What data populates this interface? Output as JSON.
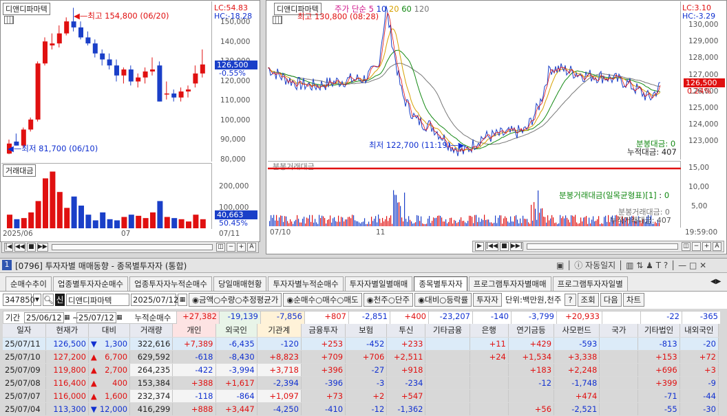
{
  "left_chart": {
    "name": "디앤디파마텍",
    "lc": "LC:54.83",
    "hc": "HC:-18.28",
    "high": "최고 154,800 (06/20)",
    "low": "최저 81,700 (06/10)",
    "yticks": [
      "150,000",
      "140,000",
      "130,000",
      "120,000",
      "110,000",
      "100,000",
      "90,000",
      "80,000"
    ],
    "price": "126,500",
    "pct": "-0.55%",
    "vol_title": "거래대금",
    "vol_yticks": [
      "200,000",
      "100,000"
    ],
    "vol_value": "40,663",
    "vol_pct": "50.45%",
    "xlabels": [
      "2025/06",
      "07",
      "07/11"
    ],
    "candles": [
      [
        82,
        89,
        81.7,
        87
      ],
      [
        88,
        92,
        86,
        86
      ],
      [
        86,
        95,
        85,
        94
      ],
      [
        94,
        100,
        93,
        99
      ],
      [
        99,
        128,
        98,
        127
      ],
      [
        127,
        140,
        126,
        138
      ],
      [
        136,
        142,
        134,
        137
      ],
      [
        137,
        146,
        135,
        142
      ],
      [
        142,
        150,
        141,
        148
      ],
      [
        148,
        154.8,
        143,
        145
      ],
      [
        145,
        148,
        139,
        140
      ],
      [
        140,
        143,
        136,
        137
      ],
      [
        137,
        139,
        130,
        132
      ],
      [
        132,
        134,
        126,
        129
      ],
      [
        129,
        132,
        124,
        126
      ],
      [
        126,
        129,
        118,
        121
      ],
      [
        121,
        125,
        117,
        124
      ],
      [
        124,
        126,
        116,
        118
      ],
      [
        118,
        122,
        115,
        120
      ],
      [
        120,
        125,
        117,
        123
      ],
      [
        123,
        130,
        121,
        124
      ],
      [
        126,
        128,
        108,
        108
      ],
      [
        112,
        118,
        109,
        112
      ],
      [
        112,
        114,
        108,
        110
      ],
      [
        110,
        115,
        108,
        113
      ],
      [
        113,
        116,
        110,
        114
      ],
      [
        117,
        126,
        115,
        122
      ],
      [
        122,
        134,
        120,
        126.5
      ]
    ],
    "vols": [
      60,
      40,
      45,
      70,
      120,
      220,
      250,
      160,
      90,
      140,
      100,
      60,
      35,
      70,
      40,
      35,
      50,
      60,
      55,
      45,
      70,
      120,
      50,
      45,
      40,
      30,
      60,
      40
    ]
  },
  "right_chart": {
    "name": "디앤디파마텍",
    "legend_prefix": "주가 단순",
    "ma": [
      "5",
      "10",
      "20",
      "60",
      "120"
    ],
    "lc": "LC:3.10",
    "hc": "HC:-3.29",
    "high": "최고 130,800 (08:28)",
    "low": "최저 122,700 (11:19)",
    "yticks": [
      "130,000",
      "129,000",
      "128,000",
      "127,000",
      "126,000",
      "125,000",
      "124,000",
      "123,000"
    ],
    "price": "126,500",
    "pct": "0.24%",
    "amt_label": "분봉대금: 0",
    "acc_label": "누적대금: 407",
    "sub_title": "분봉거래대금",
    "sub_yticks": [
      "15,00",
      "10,00",
      "5,00"
    ],
    "sub_legend": "분봉거래대금(일목균형표)[1]",
    "zero": "0",
    "sub_amt": "분봉거래대금: 0",
    "sub_acc": "누적거래대금: 407",
    "xlabels": [
      "07/10",
      "11",
      "19:59:00"
    ]
  },
  "window": {
    "num": "1",
    "title": "[0796] 투자자별 매매동향 - 종목별투자자 (통합)",
    "auto": "자동일지",
    "T": "T"
  },
  "tabs": [
    "순매수추이",
    "업종별투자자순매수",
    "업종투자자누적순매수",
    "당일매매현황",
    "투자자별누적순매수",
    "투자자별일별매매",
    "종목별투자자",
    "프로그램투자자별매매",
    "프로그램투자자일별"
  ],
  "form": {
    "code": "347850",
    "sin": "신",
    "name": "디앤디파마텍",
    "date": "2025/07/12",
    "r1": [
      "금액",
      "수량",
      "추정평균가"
    ],
    "r2": [
      "순매수",
      "매수",
      "매도"
    ],
    "r3": [
      "천주",
      "단주"
    ],
    "r4": [
      "대비",
      "등락률"
    ],
    "inv_btn": "투자자",
    "unit": "단위:백만원,천주",
    "q": "?",
    "query": "조회",
    "next": "다음",
    "chart": "차트"
  },
  "period": {
    "label": "기간",
    "from": "25/06/12",
    "to": "25/07/12",
    "acc": "누적순매수",
    "sums": [
      "+27,382",
      "-19,139",
      "-7,856",
      "+807",
      "-2,851",
      "+400",
      "-23,207",
      "-140",
      "-3,799",
      "+20,933",
      "",
      "-22",
      "-365"
    ]
  },
  "headers": [
    "일자",
    "현재가",
    "대비",
    "거래량",
    "개인",
    "외국인",
    "기관계",
    "금융투자",
    "보험",
    "투신",
    "기타금융",
    "은행",
    "연기금등",
    "사모펀드",
    "국가",
    "기타법인",
    "내외국인"
  ],
  "rows": [
    [
      "25/07/11",
      "126,500",
      "▼",
      "1,300",
      "322,616",
      "+7,389",
      "-6,435",
      "-120",
      "+253",
      "-452",
      "+233",
      "",
      "+11",
      "+429",
      "-593",
      "",
      "-813",
      "-20"
    ],
    [
      "25/07/10",
      "127,200",
      "▲",
      "6,700",
      "629,592",
      "-618",
      "-8,430",
      "+8,823",
      "+709",
      "+706",
      "+2,511",
      "",
      "+24",
      "+1,534",
      "+3,338",
      "",
      "+153",
      "+72"
    ],
    [
      "25/07/09",
      "119,800",
      "▲",
      "2,700",
      "264,235",
      "-422",
      "-3,994",
      "+3,718",
      "+396",
      "-27",
      "+918",
      "",
      "",
      "+183",
      "+2,248",
      "",
      "+696",
      "+3"
    ],
    [
      "25/07/08",
      "116,400",
      "▲",
      "400",
      "153,384",
      "+388",
      "+1,617",
      "-2,394",
      "-396",
      "-3",
      "-234",
      "",
      "",
      "-12",
      "-1,748",
      "",
      "+399",
      "-9"
    ],
    [
      "25/07/07",
      "116,000",
      "▲",
      "1,600",
      "232,374",
      "-118",
      "-864",
      "+1,097",
      "+73",
      "+2",
      "+547",
      "",
      "",
      "",
      "+474",
      "",
      "-71",
      "-44"
    ],
    [
      "25/07/04",
      "113,300",
      "▼",
      "12,000",
      "416,299",
      "+888",
      "+3,447",
      "-4,250",
      "-410",
      "-12",
      "-1,362",
      "",
      "",
      "+56",
      "-2,521",
      "",
      "-55",
      "-30"
    ]
  ]
}
